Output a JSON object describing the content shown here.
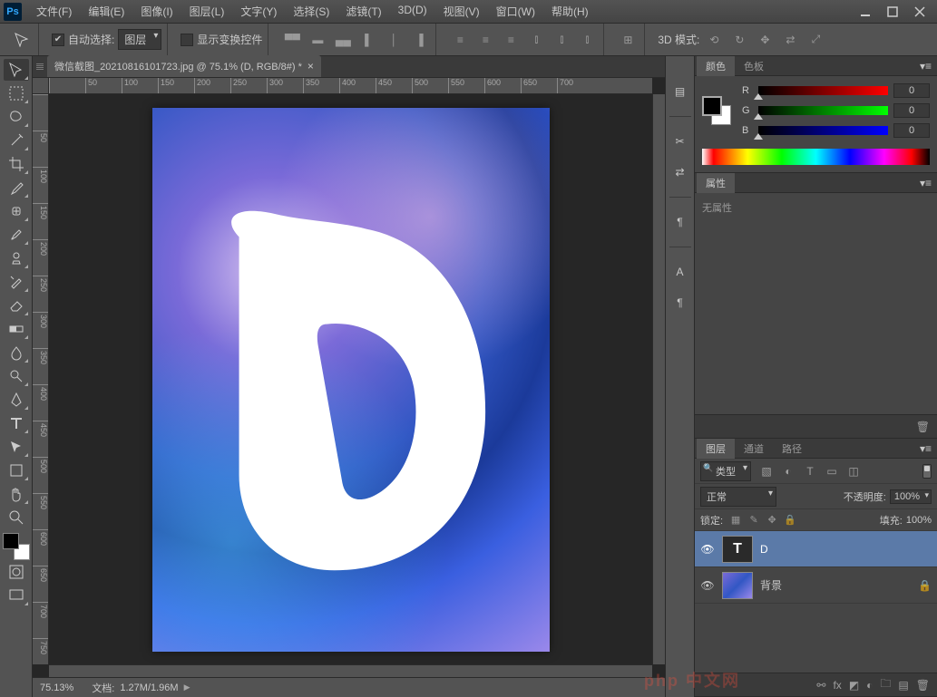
{
  "app": {
    "logo": "Ps"
  },
  "menu": {
    "file": "文件(F)",
    "edit": "编辑(E)",
    "image": "图像(I)",
    "layer": "图层(L)",
    "type": "文字(Y)",
    "select": "选择(S)",
    "filter": "滤镜(T)",
    "threeD": "3D(D)",
    "view": "视图(V)",
    "window": "窗口(W)",
    "help": "帮助(H)"
  },
  "options": {
    "auto_select": "自动选择:",
    "target": "图层",
    "show_transform": "显示变换控件",
    "threeD_mode": "3D 模式:"
  },
  "tab": {
    "title": "微信截图_20210816101723.jpg @ 75.1% (D, RGB/8#) *"
  },
  "status": {
    "zoom": "75.13%",
    "doc_label": "文档:",
    "doc_value": "1.27M/1.96M"
  },
  "ruler_h": [
    "",
    "50",
    "100",
    "150",
    "200",
    "250",
    "300",
    "350",
    "400",
    "450",
    "500",
    "550",
    "600",
    "650",
    "700"
  ],
  "ruler_v": [
    "",
    "50",
    "100",
    "150",
    "200",
    "250",
    "300",
    "350",
    "400",
    "450",
    "500",
    "550",
    "600",
    "650",
    "700",
    "750"
  ],
  "panels": {
    "color": {
      "tab_color": "颜色",
      "tab_swatch": "色板",
      "r_label": "R",
      "r_value": "0",
      "g_label": "G",
      "g_value": "0",
      "b_label": "B",
      "b_value": "0"
    },
    "properties": {
      "tab": "属性",
      "empty": "无属性"
    },
    "layers": {
      "tab_layers": "图层",
      "tab_channels": "通道",
      "tab_paths": "路径",
      "filter_kind": "类型",
      "blend": "正常",
      "opacity_label": "不透明度:",
      "opacity_value": "100%",
      "lock_label": "锁定:",
      "fill_label": "填充:",
      "fill_value": "100%",
      "layer_d": "D",
      "layer_bg": "背景"
    }
  },
  "watermark": "php 中文网"
}
